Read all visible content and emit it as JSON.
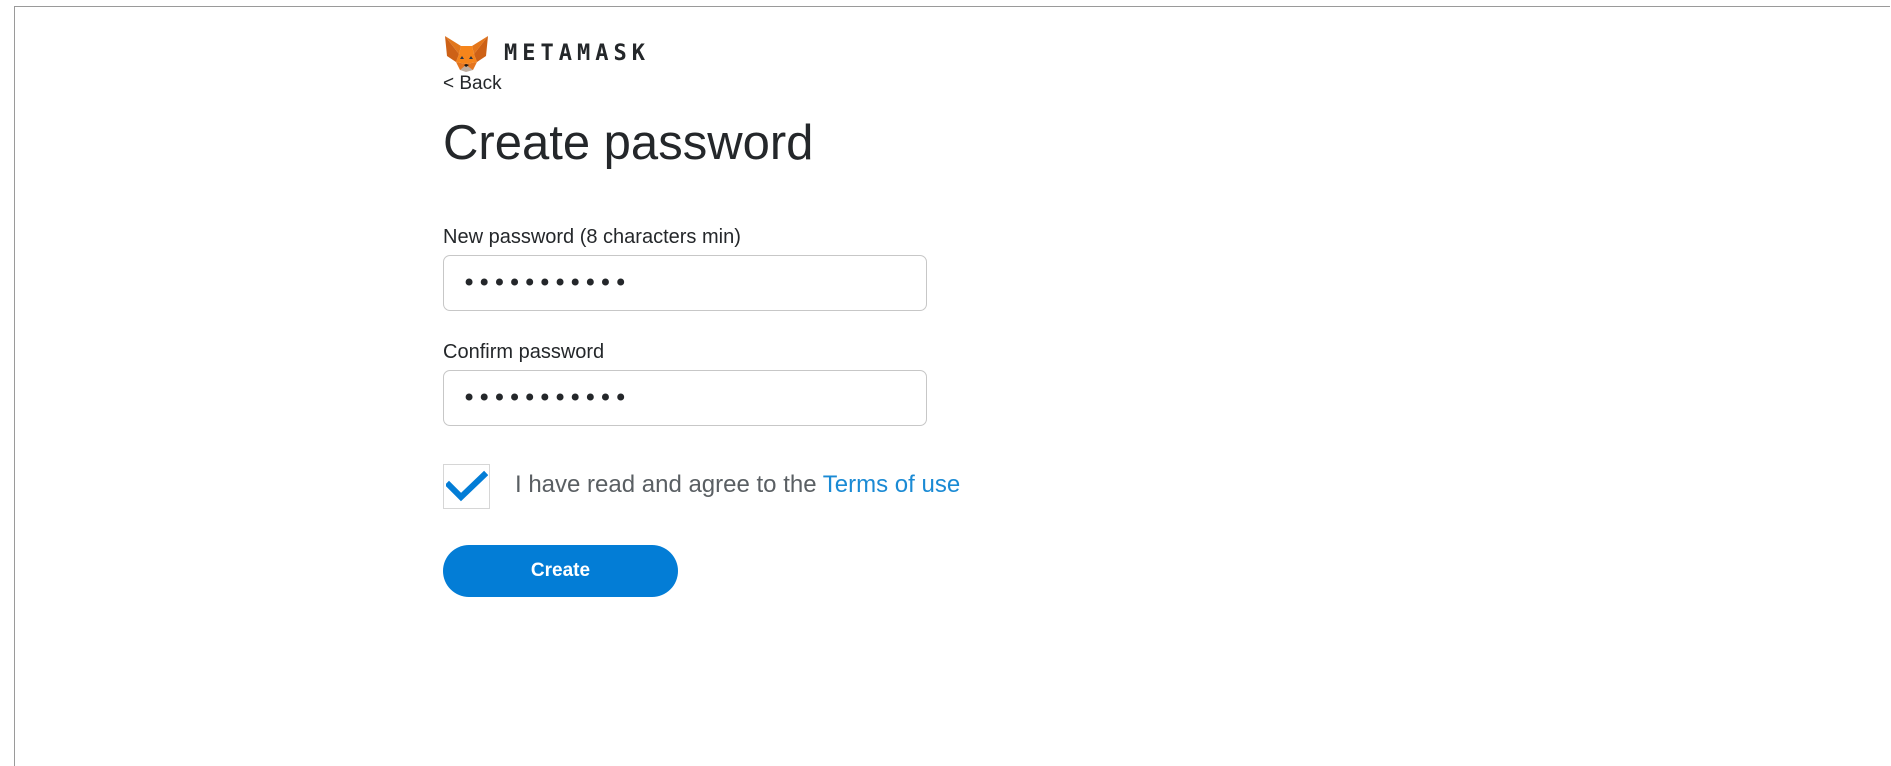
{
  "brand": {
    "name": "METAMASK",
    "logo_icon": "metamask-fox-icon"
  },
  "nav": {
    "back_label": "< Back"
  },
  "page": {
    "title": "Create password"
  },
  "form": {
    "new_password_label": "New password (8 characters min)",
    "new_password_value": "•••••••••••",
    "confirm_password_label": "Confirm password",
    "confirm_password_value": "•••••••••••",
    "terms_checked": true,
    "terms_text": "I have read and agree to the ",
    "terms_link": "Terms of use",
    "submit_label": "Create"
  },
  "colors": {
    "accent": "#037dd6",
    "link": "#1a8ad4",
    "fox_orange": "#e2761b",
    "text": "#24272a"
  }
}
